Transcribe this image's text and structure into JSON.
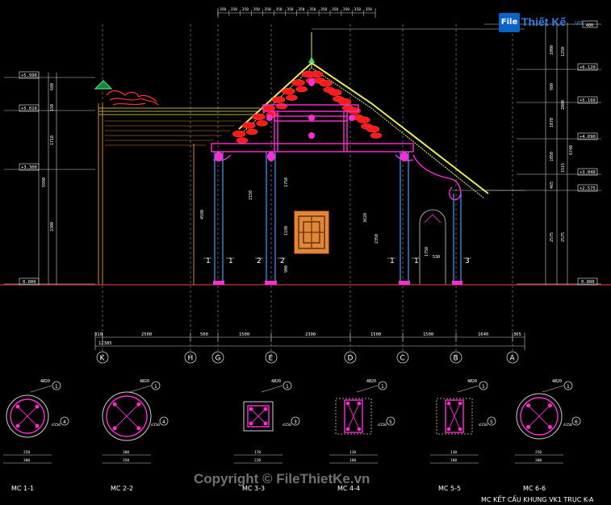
{
  "logo": {
    "mark": "File",
    "name": "Thiết Kế",
    "domain": ".vn"
  },
  "copyright": "Copyright © FileThietKe.vn",
  "drawing_title": "MC KẾT CẤU KHUNG VK1 TRỤC K-A",
  "colors": {
    "background": "#000000",
    "grid": "#bfbfbf",
    "roof_ridge": "#ff2a2a",
    "beam": "#ff2dd4",
    "column": "#3aa0ff",
    "tile": "#e8e85a",
    "timber": "#d98a3a",
    "ornament": "#ff3030",
    "dim": "#d0d0d0"
  },
  "level_labels_left": [
    "+5.990",
    "+5.010",
    "+3.300",
    "0.000"
  ],
  "level_labels_right": [
    "+6.120",
    "+5.160",
    "+4.090",
    "+3.040",
    "+2.575",
    "0.000"
  ],
  "top_dims": [
    "350",
    "350",
    "350",
    "350",
    "350",
    "350",
    "350",
    "350",
    "350",
    "350",
    "350",
    "350",
    "350",
    "350"
  ],
  "left_dims": [
    "680",
    "150",
    "1710",
    "5990",
    "3300"
  ],
  "right_dims": [
    "400",
    "1000",
    "1250",
    "980",
    "2080",
    "1070",
    "1050",
    "1515",
    "465",
    "6740",
    "2575",
    "2575"
  ],
  "inner_dims": [
    "2150",
    "1750",
    "1190",
    "900",
    "4590",
    "3620",
    "2350",
    "1750",
    "250",
    "235",
    "530"
  ],
  "bottom_dims": [
    "310",
    "2500",
    "500",
    "1500",
    "2300",
    "1500",
    "1500",
    "1640",
    "365"
  ],
  "total_dim": "12385",
  "axes": [
    "K",
    "H",
    "G",
    "E",
    "D",
    "C",
    "B",
    "A"
  ],
  "column_marks": [
    "1",
    "1",
    "2",
    "2",
    "1",
    "1",
    "3"
  ],
  "sections": [
    {
      "title": "MC 1-1",
      "rebar": "4Ø20",
      "stirrup": "d150",
      "dim_w": "300",
      "dim_in": "250",
      "marker": "1",
      "marker2": "4"
    },
    {
      "title": "MC 2-2",
      "rebar": "4Ø20",
      "stirrup": "d150",
      "dim_w": "350",
      "dim_in": "300",
      "marker": "1",
      "marker2": "4"
    },
    {
      "title": "MC 3-3",
      "rebar": "4Ø20",
      "stirrup": "d150",
      "dim_w": "220",
      "dim_in": "170",
      "marker": "1",
      "marker2": "3"
    },
    {
      "title": "MC 4-4",
      "rebar": "4Ø20",
      "stirrup": "d150",
      "dim_w": "180",
      "dim_in": "130",
      "marker": "1",
      "marker2": "5"
    },
    {
      "title": "MC 5-5",
      "rebar": "4Ø20",
      "stirrup": "d150",
      "dim_w": "180",
      "dim_in": "130",
      "marker": "1",
      "marker2": "5"
    },
    {
      "title": "MC 6-6",
      "rebar": "4Ø20",
      "stirrup": "d150",
      "dim_w": "300",
      "dim_in": "250",
      "marker": "1",
      "marker2": "6"
    }
  ]
}
